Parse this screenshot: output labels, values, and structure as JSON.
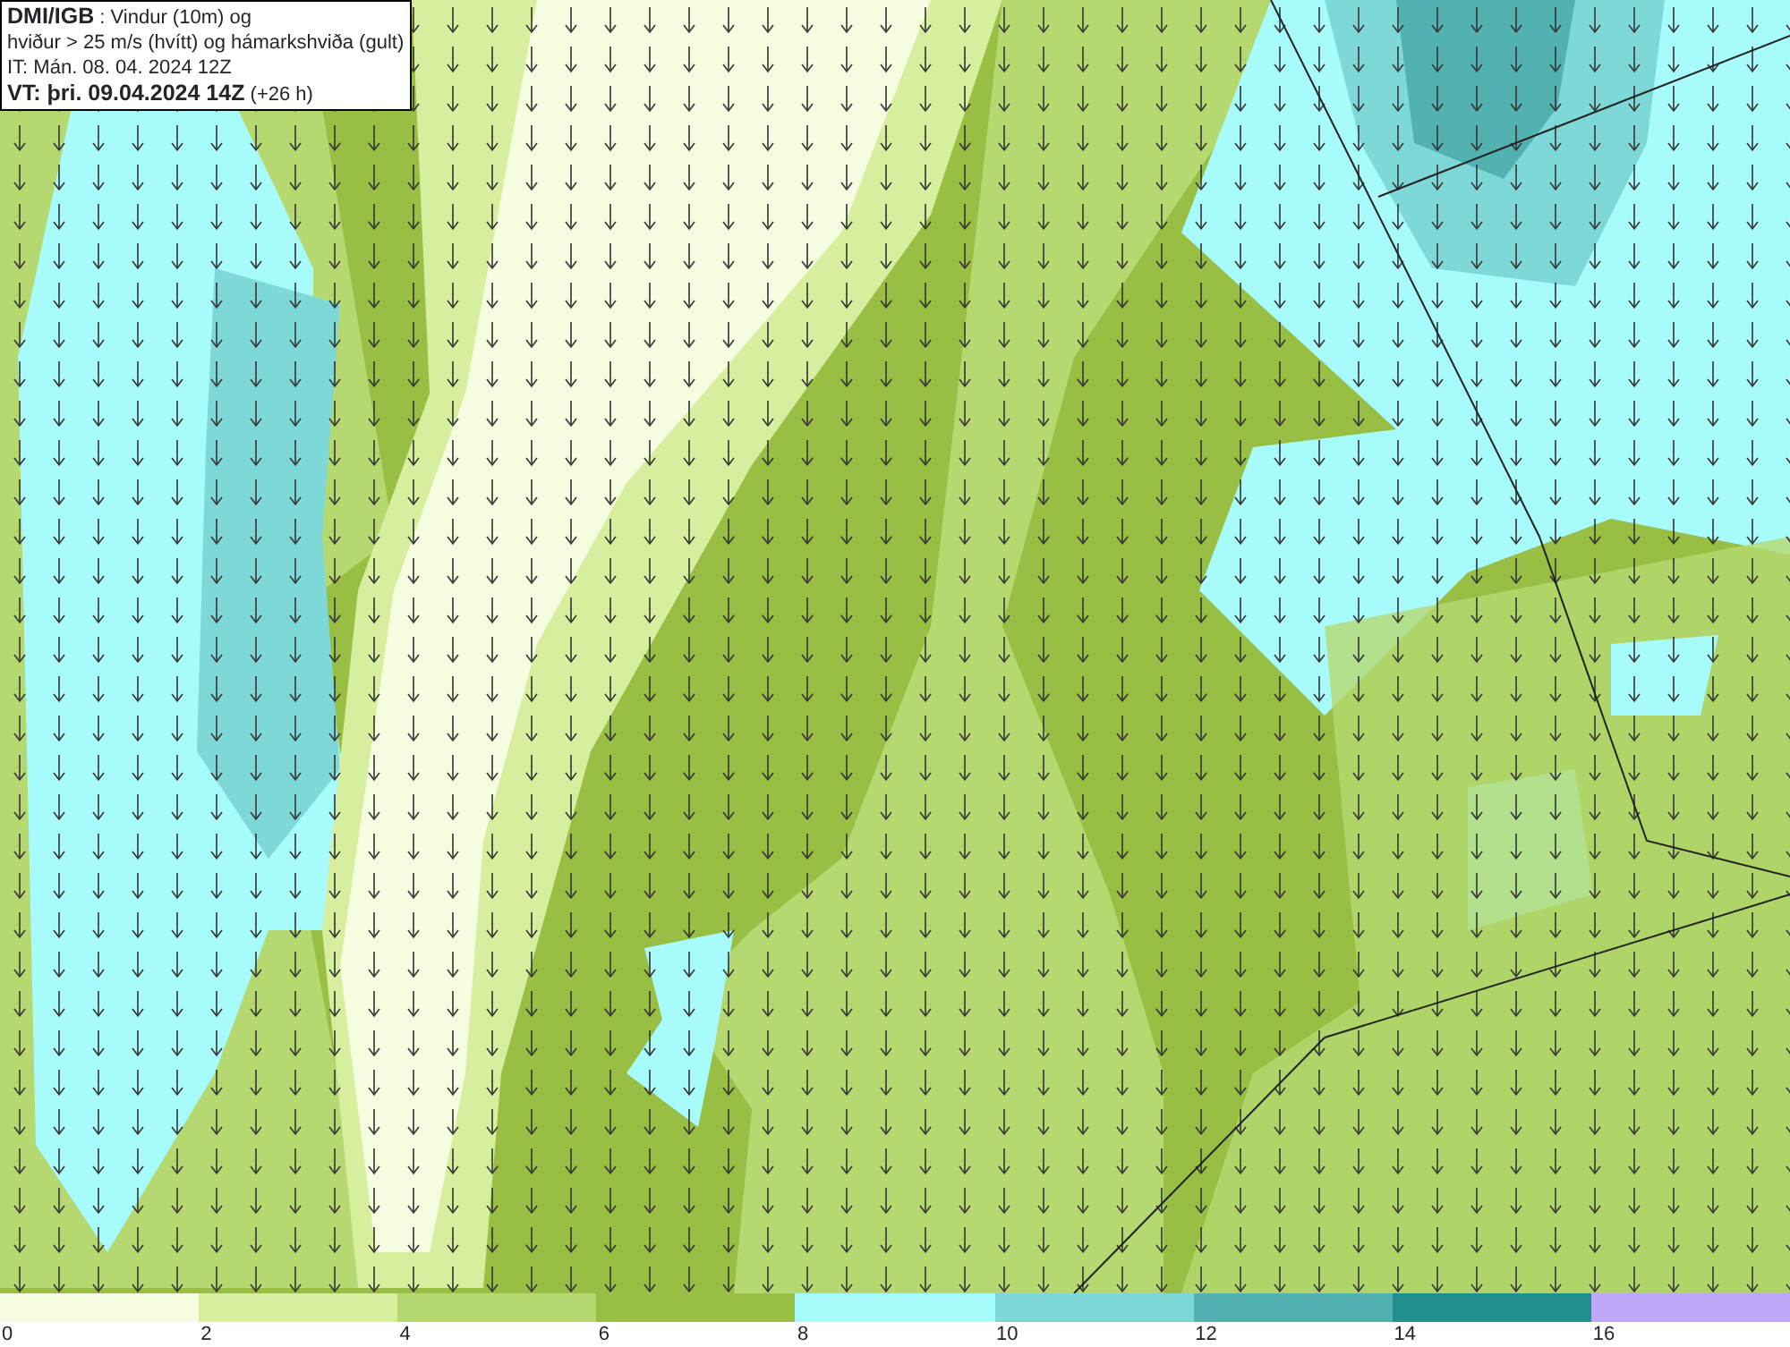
{
  "header": {
    "lines": [
      "**DMI/IGB** : Vindur (10m) og",
      "hviður > 25 m/s (hvítt) og hámarkshviða (gult)",
      "IT: Mán. 08. 04. 2024 12Z",
      "**VT: þri. 09.04.2024 14Z** (+26 h)"
    ]
  },
  "legend": {
    "segments": [
      {
        "color": "#f5fce0"
      },
      {
        "color": "#d7ee9f"
      },
      {
        "color": "#b5d970"
      },
      {
        "color": "#98be44"
      },
      {
        "color": "#a8fbfb"
      },
      {
        "color": "#7fd8d8"
      },
      {
        "color": "#52b2b2"
      },
      {
        "color": "#228f8f"
      },
      {
        "color": "#c0a8f8"
      }
    ],
    "labels": [
      "0",
      "2",
      "4",
      "6",
      "8",
      "10",
      "12",
      "14",
      "16"
    ]
  }
}
